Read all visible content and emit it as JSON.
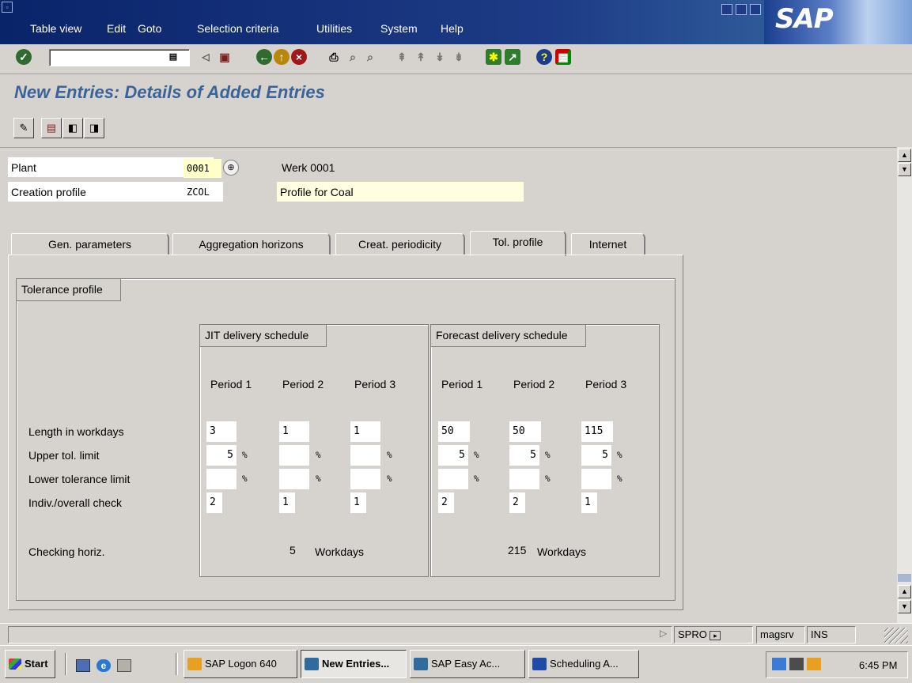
{
  "menu": {
    "items": [
      "Table view",
      "Edit",
      "Goto",
      "Selection criteria",
      "Utilities",
      "System",
      "Help"
    ]
  },
  "brand": {
    "logo_text": "SAP"
  },
  "toolbar": {
    "command_field_value": "",
    "icons": [
      "enter-icon",
      "history-icon",
      "back-nav-icon",
      "save-icon",
      "back-icon",
      "exit-icon",
      "cancel-icon",
      "print-icon",
      "find-icon",
      "find-next-icon",
      "first-page-icon",
      "previous-page-icon",
      "next-page-icon",
      "last-page-icon",
      "create-session-icon",
      "shortcut-icon",
      "help-icon",
      "layout-icon"
    ]
  },
  "page": {
    "title": "New Entries: Details of Added Entries"
  },
  "header_fields": {
    "plant_label": "Plant",
    "plant_value": "0001",
    "plant_desc": "Werk 0001",
    "profile_label": "Creation profile",
    "profile_value": "ZCOL",
    "profile_desc": "Profile for Coal"
  },
  "tabs": [
    {
      "label": "Gen. parameters",
      "active": false
    },
    {
      "label": "Aggregation horizons",
      "active": false
    },
    {
      "label": "Creat. periodicity",
      "active": false
    },
    {
      "label": "Tol. profile",
      "active": true
    },
    {
      "label": "Internet",
      "active": false
    }
  ],
  "tolerance": {
    "group_title": "Tolerance profile",
    "jit_title": "JIT delivery schedule",
    "fc_title": "Forecast delivery schedule",
    "period_headers": [
      "Period 1",
      "Period 2",
      "Period 3"
    ],
    "row_labels": {
      "length": "Length in workdays",
      "upper": "Upper tol. limit",
      "lower": "Lower tolerance limit",
      "check": "Indiv./overall check",
      "horizon": "Checking horiz."
    },
    "percent_sign": "%",
    "jit": {
      "length": [
        "3",
        "1",
        "1"
      ],
      "upper": [
        "5",
        "",
        ""
      ],
      "lower": [
        "",
        "",
        ""
      ],
      "check": [
        "2",
        "1",
        "1"
      ],
      "horizon_value": "5",
      "horizon_unit": "Workdays"
    },
    "forecast": {
      "length": [
        "50",
        "50",
        "115"
      ],
      "upper": [
        "5",
        "5",
        "5"
      ],
      "lower": [
        "",
        "",
        ""
      ],
      "check": [
        "2",
        "2",
        "1"
      ],
      "horizon_value": "215",
      "horizon_unit": "Workdays"
    }
  },
  "statusbar": {
    "transaction": "SPRO",
    "server": "magsrv",
    "mode": "INS"
  },
  "taskbar": {
    "start_label": "Start",
    "buttons": [
      "SAP Logon 640",
      "New Entries...",
      "SAP Easy Ac...",
      "Scheduling A..."
    ],
    "clock": "6:45 PM"
  },
  "colors": {
    "title_blue": "#3a6499",
    "highlight_field": "#ffffc8",
    "desc_field": "#ffffe0"
  }
}
